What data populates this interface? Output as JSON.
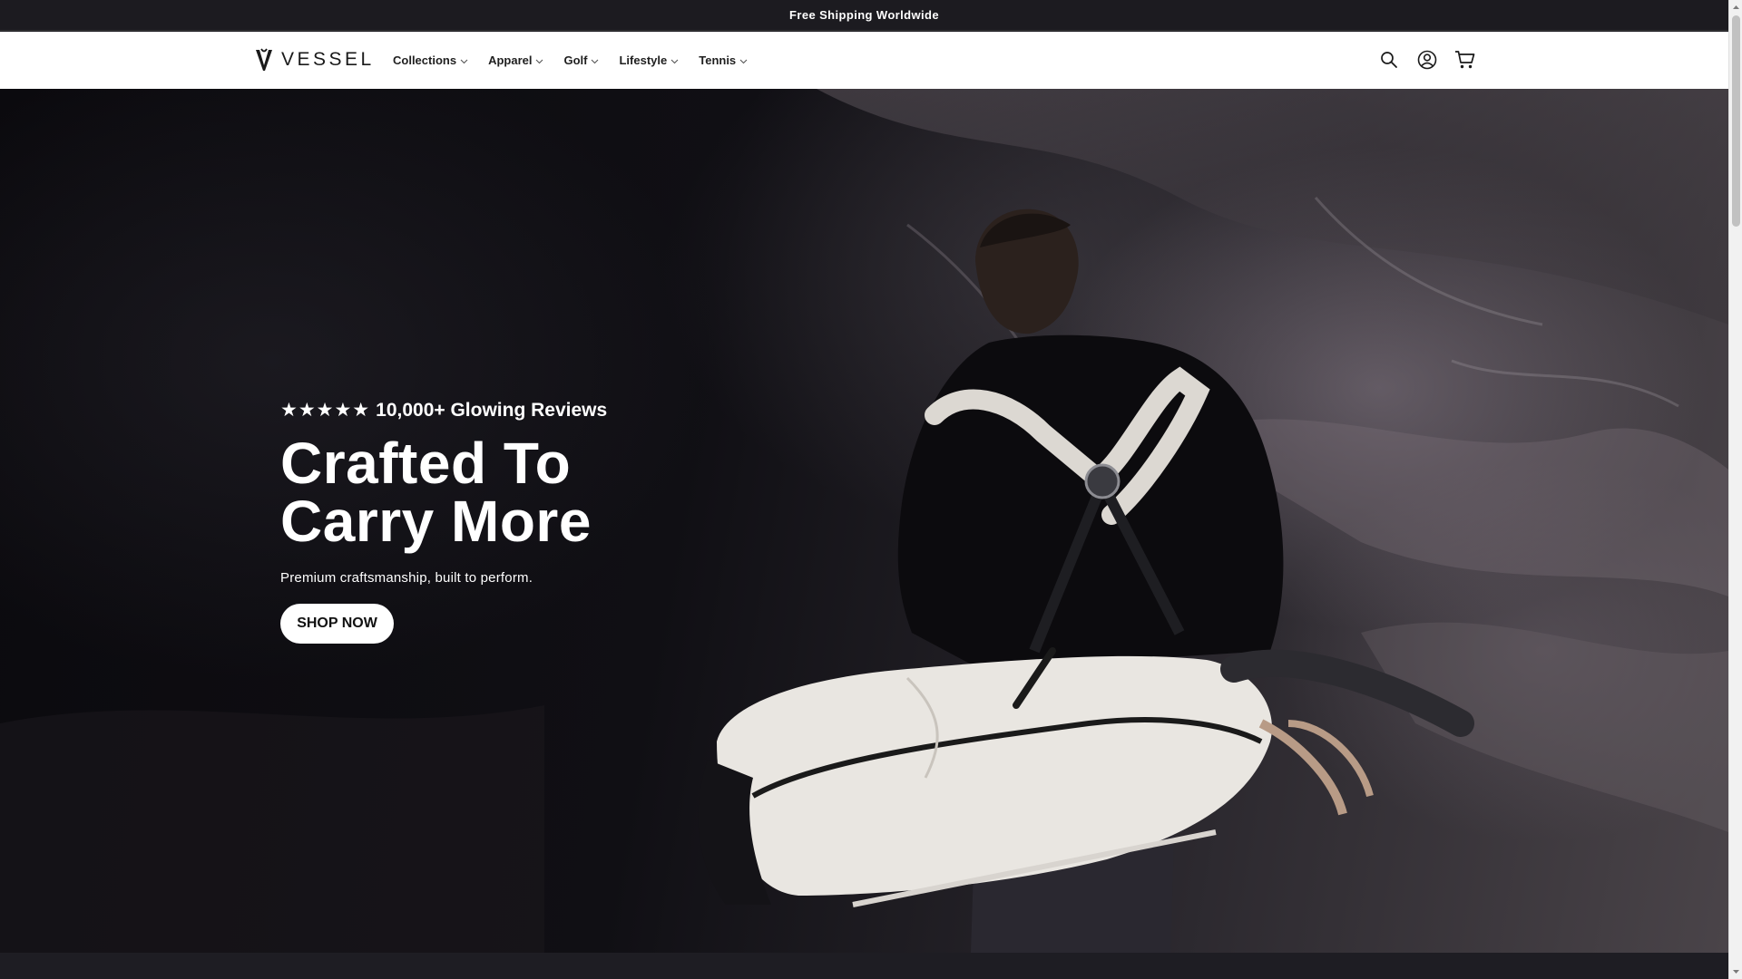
{
  "announcement": {
    "text": "Free Shipping Worldwide"
  },
  "header": {
    "logo_text": "VESSEL",
    "nav": [
      {
        "label": "Collections"
      },
      {
        "label": "Apparel"
      },
      {
        "label": "Golf"
      },
      {
        "label": "Lifestyle"
      },
      {
        "label": "Tennis"
      }
    ],
    "icons": [
      "search-icon",
      "account-icon",
      "cart-icon"
    ]
  },
  "hero": {
    "stars": "★★★★★",
    "reviews_text": "10,000+ Glowing Reviews",
    "headline_line1": "Crafted To",
    "headline_line2": "Carry More",
    "subtext": "Premium craftsmanship, built to perform.",
    "cta_label": "SHOP NOW"
  },
  "colors": {
    "announcement_bg": "#1c1b20",
    "header_bg": "#ffffff",
    "hero_text": "#ffffff",
    "cta_bg": "#ffffff",
    "cta_text": "#111111"
  }
}
